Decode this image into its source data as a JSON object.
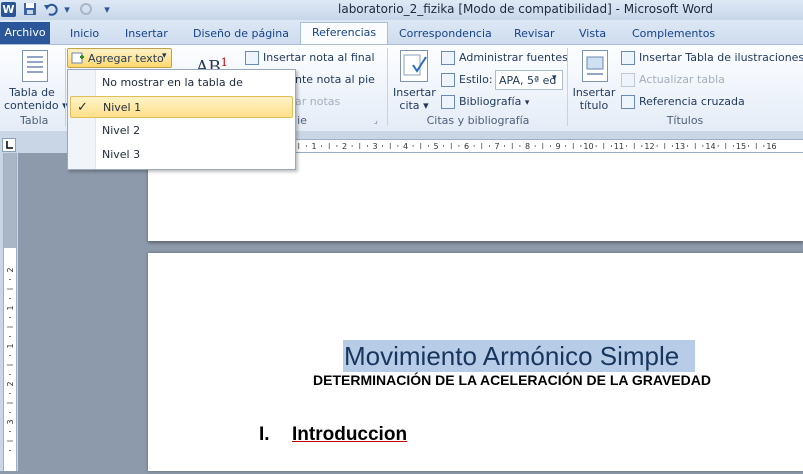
{
  "window": {
    "app_badge": "W",
    "title": "laboratorio_2_fizika [Modo de compatibilidad] - Microsoft Word"
  },
  "quick_access": [
    "save-icon",
    "undo-icon",
    "redo-icon",
    "customize-icon"
  ],
  "tabs": [
    {
      "label": "Archivo"
    },
    {
      "label": "Inicio"
    },
    {
      "label": "Insertar"
    },
    {
      "label": "Diseño de página"
    },
    {
      "label": "Referencias"
    },
    {
      "label": "Correspondencia"
    },
    {
      "label": "Revisar"
    },
    {
      "label": "Vista"
    },
    {
      "label": "Complementos"
    }
  ],
  "active_tab": "Referencias",
  "ribbon": {
    "toc": {
      "button_label_1": "Tabla de",
      "button_label_2": "contenido",
      "group_label": "Tabla"
    },
    "agregar_texto": "Agregar texto",
    "footnotes": {
      "insert_footnote_fragment": "AB",
      "insert_footnote_sup": "1",
      "insert_endnote": "Insertar nota al final",
      "next_footnote": "nte nota al pie",
      "show_notes": "ar notas",
      "group_label": "ie"
    },
    "citations": {
      "insert_citation_1": "Insertar",
      "insert_citation_2": "cita",
      "manage_sources": "Administrar fuentes",
      "style_label": "Estilo:",
      "style_value": "APA, 5ª ed",
      "bibliography": "Bibliografía",
      "group_label": "Citas y bibliografía"
    },
    "captions": {
      "insert_caption_1": "Insertar",
      "insert_caption_2": "título",
      "insert_table_figures": "Insertar Tabla de ilustraciones",
      "update_table": "Actualizar tabla",
      "cross_reference": "Referencia cruzada",
      "group_label": "Títulos"
    }
  },
  "dropdown": {
    "items": [
      {
        "label": "No mostrar en la tabla de contenido",
        "checked": false
      },
      {
        "label": "Nivel 1",
        "checked": true
      },
      {
        "label": "Nivel 2",
        "checked": false
      },
      {
        "label": "Nivel 3",
        "checked": false
      }
    ],
    "check_glyph": "✓"
  },
  "ruler": {
    "h_labels": [
      "1",
      "2",
      "3",
      "4",
      "5",
      "6",
      "7",
      "8",
      "9",
      "10",
      "11",
      "12",
      "13",
      "14",
      "15",
      "16"
    ],
    "v_labels": [
      "2",
      "1",
      "1",
      "2",
      "3"
    ]
  },
  "document": {
    "title": "Movimiento Armónico Simple",
    "subtitle": "DETERMINACIÓN DE LA ACELERACIÓN DE LA GRAVEDAD",
    "section_number": "I.",
    "section_title": "Introduccion"
  },
  "colors": {
    "file_tab": "#2b579a",
    "selection_highlight": "#b7cde7",
    "menu_hover": "#ffe08a",
    "spellcheck_underline": "#c00000"
  }
}
